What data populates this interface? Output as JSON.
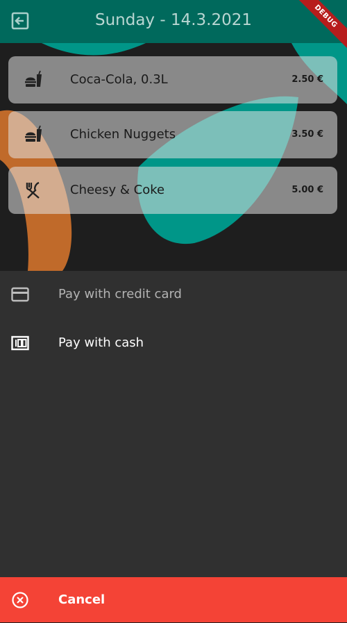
{
  "header": {
    "title": "Sunday - 14.3.2021",
    "back_icon": "logout-icon"
  },
  "debug_label": "DEBUG",
  "orders": [
    {
      "name": "Coca-Cola, 0.3L",
      "price": "2.50 €",
      "icon": "fastfood-icon"
    },
    {
      "name": "Chicken Nuggets",
      "price": "3.50 €",
      "icon": "fastfood-icon"
    },
    {
      "name": "Cheesy & Coke",
      "price": "5.00 €",
      "icon": "restaurant-icon"
    }
  ],
  "payment_options": [
    {
      "label": "Pay with credit card",
      "icon": "credit-card-icon"
    },
    {
      "label": "Pay with cash",
      "icon": "money-icon"
    }
  ],
  "cancel": {
    "label": "Cancel",
    "icon": "cancel-icon"
  },
  "colors": {
    "appbar": "#00695c",
    "accent_teal": "#009688",
    "accent_orange": "#c06a2a",
    "sheet": "#303030",
    "cancel": "#f44336"
  }
}
